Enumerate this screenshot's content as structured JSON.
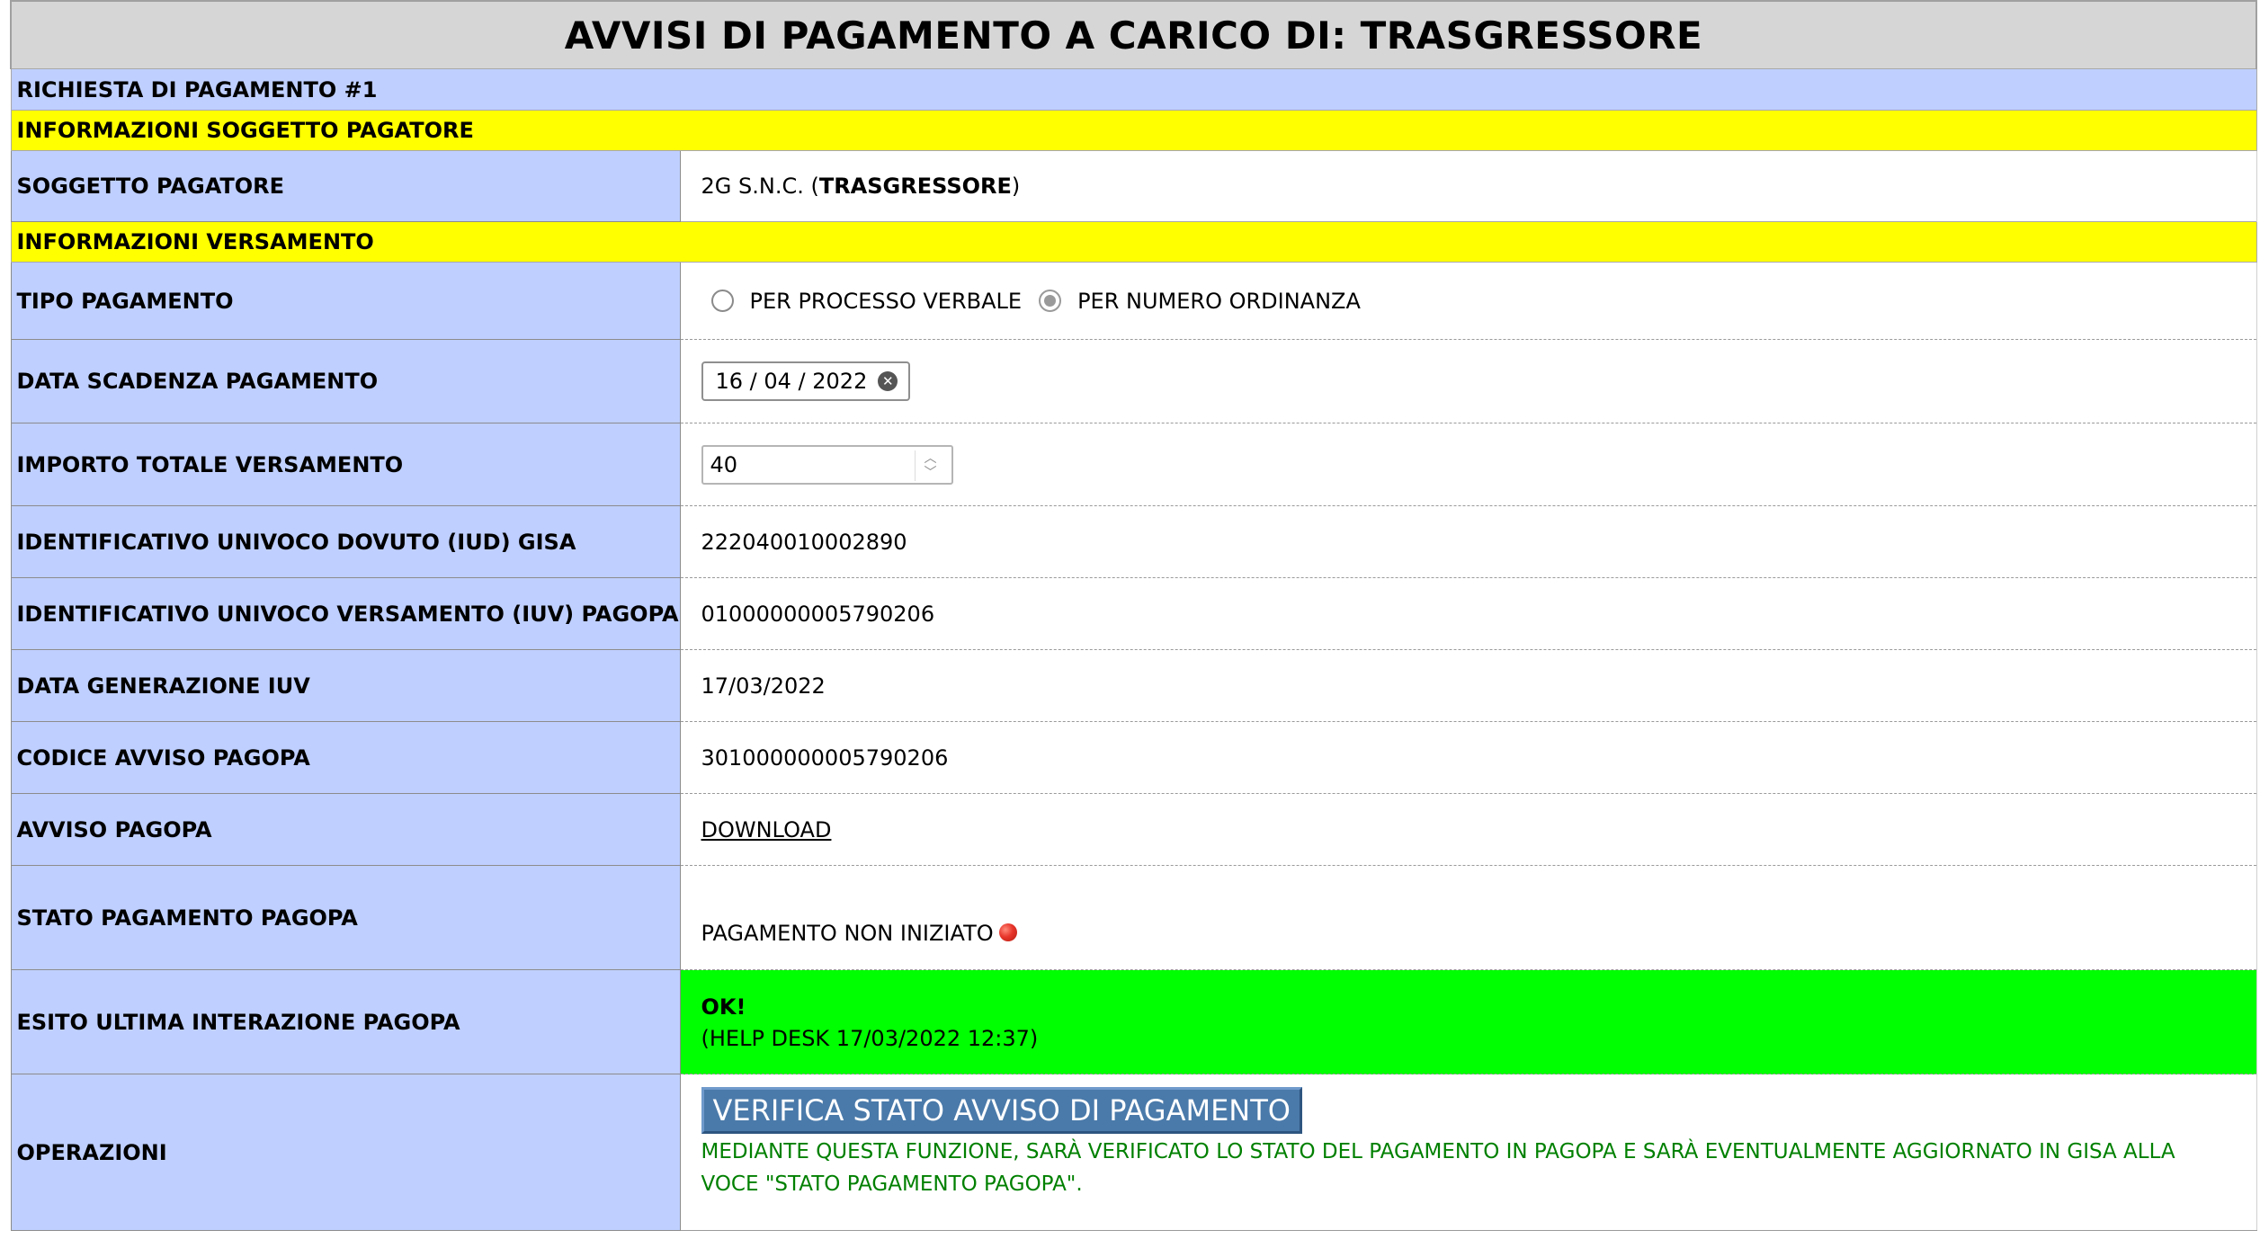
{
  "title": "AVVISI DI PAGAMENTO A CARICO DI: TRASGRESSORE",
  "request_header": "RICHIESTA DI PAGAMENTO #1",
  "section_payer": "INFORMAZIONI SOGGETTO PAGATORE",
  "section_payment": "INFORMAZIONI VERSAMENTO",
  "payer": {
    "label": "SOGGETTO PAGATORE",
    "name": "2G S.N.C. (",
    "role": "TRASGRESSORE",
    "close": ")"
  },
  "payment_type": {
    "label": "TIPO PAGAMENTO",
    "options": [
      {
        "label": "PER PROCESSO VERBALE",
        "checked": false
      },
      {
        "label": "PER NUMERO ORDINANZA",
        "checked": true
      }
    ]
  },
  "due_date": {
    "label": "DATA SCADENZA PAGAMENTO",
    "value": "16 / 04 / 2022"
  },
  "amount": {
    "label": "IMPORTO TOTALE VERSAMENTO",
    "value": "40"
  },
  "iud": {
    "label": "IDENTIFICATIVO UNIVOCO DOVUTO (IUD) GISA",
    "value": "222040010002890"
  },
  "iuv": {
    "label": "IDENTIFICATIVO UNIVOCO VERSAMENTO (IUV) PAGOPA",
    "value": "01000000005790206"
  },
  "iuv_date": {
    "label": "DATA GENERAZIONE IUV",
    "value": "17/03/2022"
  },
  "notice_code": {
    "label": "CODICE AVVISO PAGOPA",
    "value": "301000000005790206"
  },
  "notice": {
    "label": "AVVISO PAGOPA",
    "link": "DOWNLOAD"
  },
  "status": {
    "label": "STATO PAGAMENTO PAGOPA",
    "value": "PAGAMENTO NON INIZIATO",
    "color": "#e8352a"
  },
  "last_result": {
    "label": "ESITO ULTIMA INTERAZIONE PAGOPA",
    "result": "OK!",
    "detail": "(HELP DESK 17/03/2022 12:37)",
    "color": "#00ff00"
  },
  "operations": {
    "label": "OPERAZIONI",
    "button": "VERIFICA STATO AVVISO DI PAGAMENTO",
    "note": "MEDIANTE QUESTA FUNZIONE, SARÀ VERIFICATO LO STATO DEL PAGAMENTO IN PAGOPA E SARÀ EVENTUALMENTE AGGIORNATO IN GISA ALLA VOCE \"STATO PAGAMENTO PAGOPA\"."
  }
}
